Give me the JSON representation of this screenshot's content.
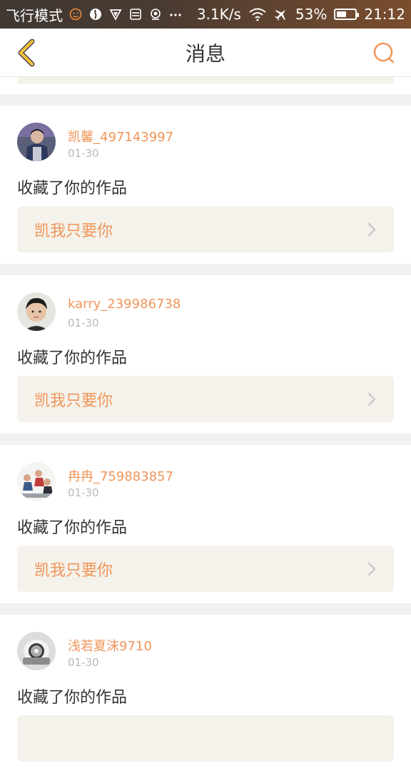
{
  "status_bar": {
    "airplane_mode_label": "飞行模式",
    "network_speed": "3.1K/s",
    "battery_percent": "53%",
    "battery_level": 0.53,
    "time": "21:12"
  },
  "header": {
    "title": "消息",
    "back_icon": "chevron-left-icon",
    "search_icon": "search-icon"
  },
  "colors": {
    "accent": "#f0955a",
    "card_box": "#f4f2ea",
    "back_icon": "#f5c33b"
  },
  "messages": [
    {
      "username": "凯馨_497143997",
      "date": "01-30",
      "action": "收藏了你的作品",
      "work_title": "凯我只要你"
    },
    {
      "username": "karry_239986738",
      "date": "01-30",
      "action": "收藏了你的作品",
      "work_title": "凯我只要你"
    },
    {
      "username": "冉冉_759883857",
      "date": "01-30",
      "action": "收藏了你的作品",
      "work_title": "凯我只要你"
    },
    {
      "username": "浅若夏沫9710",
      "date": "01-30",
      "action": "收藏了你的作品",
      "work_title": ""
    }
  ]
}
